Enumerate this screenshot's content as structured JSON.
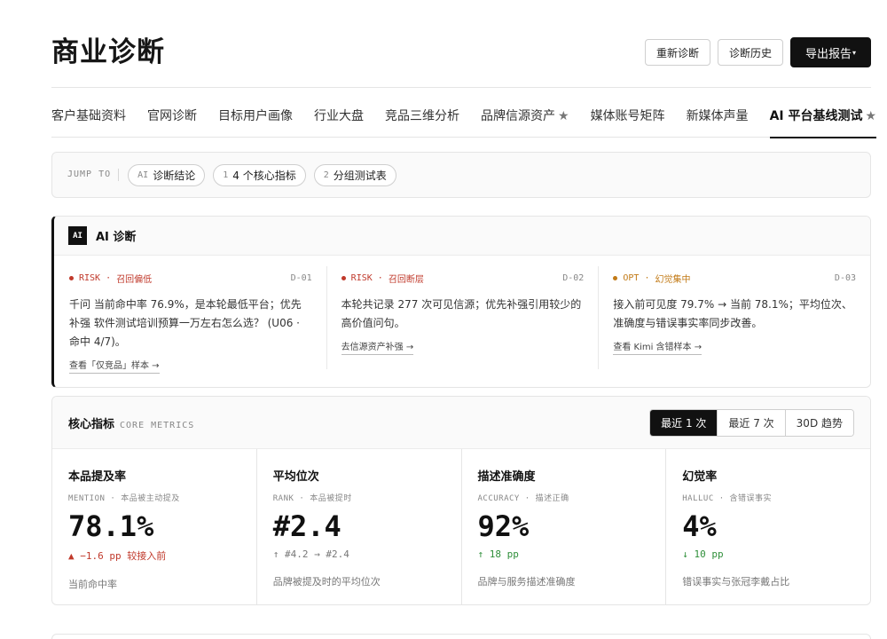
{
  "header": {
    "title": "商业诊断",
    "buttons": {
      "rediagnose": "重新诊断",
      "history": "诊断历史",
      "export": "导出报告"
    },
    "export_caret": "▾"
  },
  "tabs": [
    {
      "label": "客户基础资料",
      "star": ""
    },
    {
      "label": "官网诊断",
      "star": ""
    },
    {
      "label": "目标用户画像",
      "star": ""
    },
    {
      "label": "行业大盘",
      "star": ""
    },
    {
      "label": "竞品三维分析",
      "star": ""
    },
    {
      "label": "品牌信源资产",
      "star": "★"
    },
    {
      "label": "媒体账号矩阵",
      "star": ""
    },
    {
      "label": "新媒体声量",
      "star": ""
    },
    {
      "label": "AI 平台基线测试",
      "star": "★"
    }
  ],
  "jump": {
    "label": "JUMP TO",
    "chips": [
      {
        "pre": "AI",
        "label": "诊断结论"
      },
      {
        "pre": "1",
        "label": "4 个核心指标"
      },
      {
        "pre": "2",
        "label": "分组测试表"
      }
    ]
  },
  "ai_diagnosis": {
    "badge": "AI",
    "title": "AI 诊断",
    "items": [
      {
        "kind": "RISK",
        "sep": "·",
        "tag": "召回偏低",
        "id": "D-01",
        "text": "千问 当前命中率 76.9%，是本轮最低平台；优先补强 软件测试培训预算一万左右怎么选？ (U06 · 命中 4/7)。",
        "link": "查看「仅竞品」样本 →"
      },
      {
        "kind": "RISK",
        "sep": "·",
        "tag": "召回断层",
        "id": "D-02",
        "text": "本轮共记录 277 次可见信源；优先补强引用较少的高价值问句。",
        "link": "去信源资产补强 →"
      },
      {
        "kind": "OPT",
        "sep": "·",
        "tag": "幻觉集中",
        "id": "D-03",
        "text": "接入前可见度 79.7% → 当前 78.1%；平均位次、准确度与错误事实率同步改善。",
        "link": "查看 Kimi 含错样本 →"
      }
    ]
  },
  "metrics": {
    "title": "核心指标",
    "subtitle": "CORE METRICS",
    "ranges": [
      "最近 1 次",
      "最近 7 次",
      "30D 趋势"
    ],
    "active_range": "最近 1 次",
    "items": [
      {
        "title": "本品提及率",
        "code": "MENTION",
        "sep": "·",
        "sub": "本品被主动提及",
        "value": "78.1%",
        "delta": "▲ −1.6 pp 较接入前",
        "trend": "down",
        "desc": "当前命中率"
      },
      {
        "title": "平均位次",
        "code": "RANK",
        "sep": "·",
        "sub": "本品被提时",
        "value": "#2.4",
        "delta": "↑ #4.2 → #2.4",
        "trend": "neutral",
        "desc": "品牌被提及时的平均位次"
      },
      {
        "title": "描述准确度",
        "code": "ACCURACY",
        "sep": "·",
        "sub": "描述正确",
        "value": "92%",
        "delta": "↑ 18 pp",
        "trend": "up",
        "desc": "品牌与服务描述准确度"
      },
      {
        "title": "幻觉率",
        "code": "HALLUC",
        "sep": "·",
        "sub": "含错误事实",
        "value": "4%",
        "delta": "↓ 10 pp",
        "trend": "up",
        "desc": "错误事实与张冠李戴占比"
      }
    ]
  },
  "colors": {
    "risk": "#c0392b",
    "opt": "#c27a16",
    "up": "#2f8f3a",
    "accent": "#111111"
  }
}
